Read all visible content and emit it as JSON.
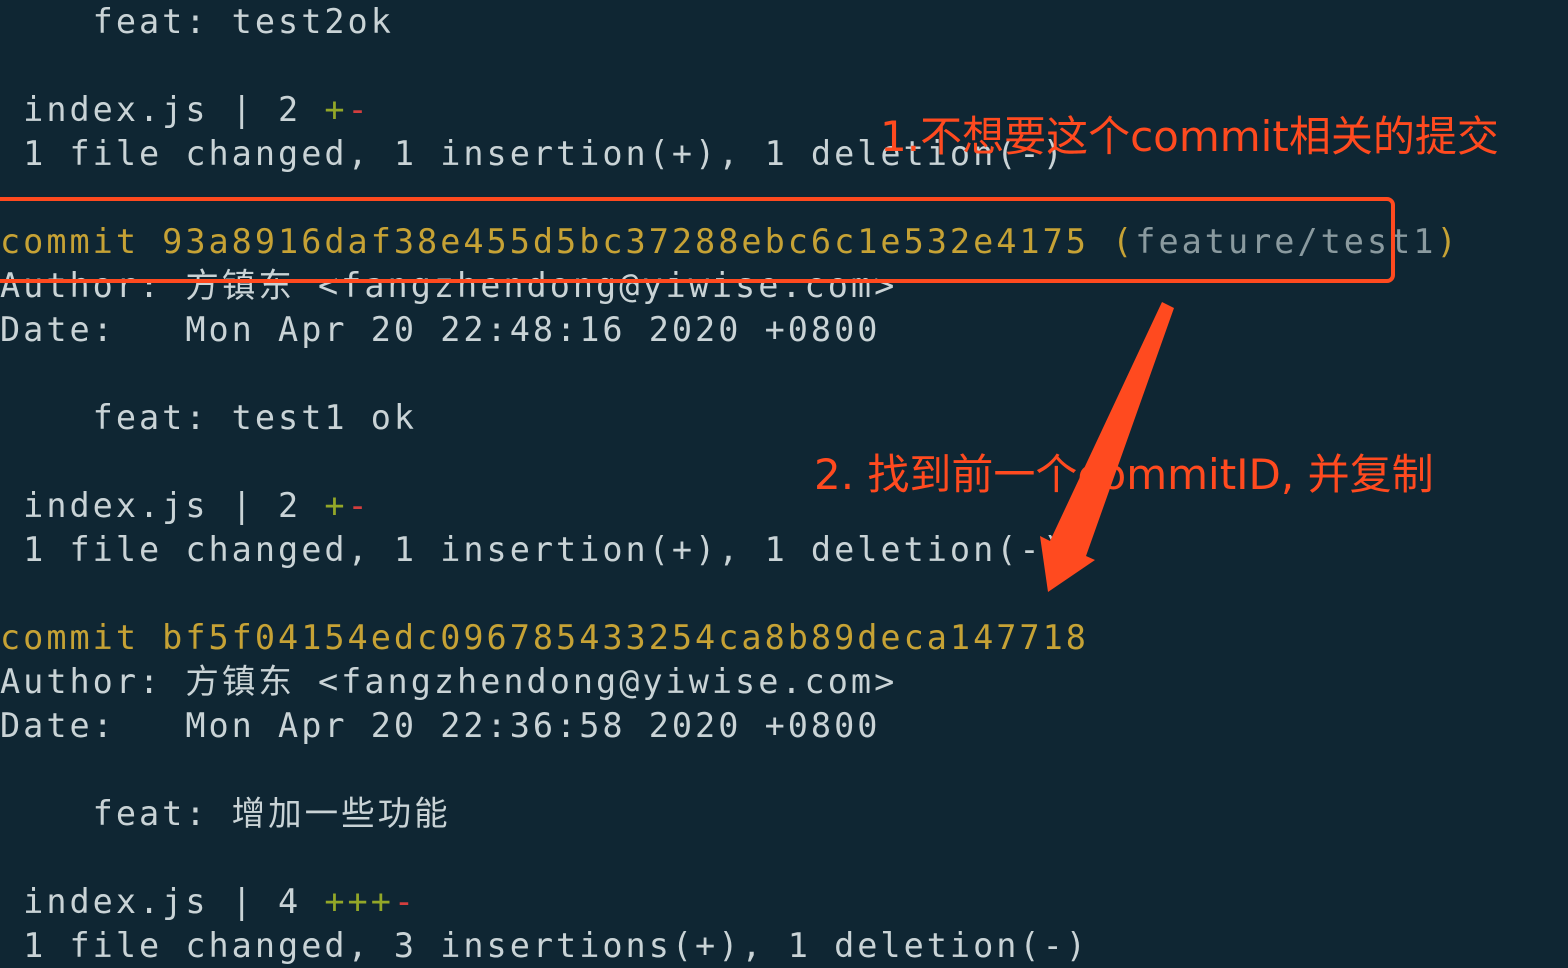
{
  "terminal": {
    "block0": {
      "message": "    feat: test2ok",
      "stat_file": " index.js | 2 ",
      "stat_plus": "+",
      "stat_minus": "-",
      "summary": " 1 file changed, 1 insertion(+), 1 deletion(-)"
    },
    "block1": {
      "commit_label": "commit 93a8916daf38e455d5bc37288ebc6c1e532e4175 (",
      "branch": "feature/test1",
      "branch_close": ")",
      "author": "Author: 方镇东 <fangzhendong@yiwise.com>",
      "date": "Date:   Mon Apr 20 22:48:16 2020 +0800",
      "message": "    feat: test1 ok",
      "stat_file": " index.js | 2 ",
      "stat_plus": "+",
      "stat_minus": "-",
      "summary": " 1 file changed, 1 insertion(+), 1 deletion(-)"
    },
    "block2": {
      "commit_label": "commit bf5f04154edc096785433254ca8b89deca147718",
      "author": "Author: 方镇东 <fangzhendong@yiwise.com>",
      "date": "Date:   Mon Apr 20 22:36:58 2020 +0800",
      "message": "    feat: 增加一些功能",
      "stat_file": " index.js | 4 ",
      "stat_plus": "+++",
      "stat_minus": "-",
      "summary": " 1 file changed, 3 insertions(+), 1 deletion(-)"
    }
  },
  "annotations": {
    "note1": "1.不想要这个commit相关的提交",
    "note2": "2. 找到前一个commitID, 并复制"
  },
  "colors": {
    "background": "#0f2633",
    "text": "#c9d3d6",
    "commit_hash": "#c6a235",
    "insertion": "#93a728",
    "deletion": "#d33e3e",
    "annotation": "#ff4a1f"
  }
}
